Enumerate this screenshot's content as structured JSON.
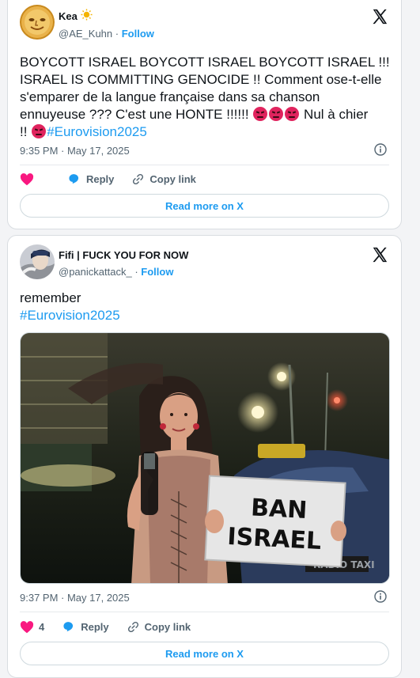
{
  "tweets": [
    {
      "display_name": "Kea",
      "name_emoji": "☀️",
      "handle": "@AE_Kuhn",
      "separator": "·",
      "follow_label": "Follow",
      "text_line1": "BOYCOTT ISRAEL BOYCOTT ISRAEL BOYCOTT ISRAEL !!!",
      "text_line2": "ISRAEL IS COMMITTING GENOCIDE !! Comment ose-t-elle",
      "text_line3": "s'emparer de la langue française dans sa chanson",
      "text_line4": "ennuyeuse ??? C'est une HONTE !!!!!!",
      "text_line4_end": "Nul à chier",
      "text_line5_start": "!!",
      "hashtag": "#Eurovision2025",
      "timestamp": "9:35 PM · May 17, 2025",
      "like_count": "",
      "reply_label": "Reply",
      "copy_label": "Copy link",
      "read_more_label": "Read more on X"
    },
    {
      "display_name": "Fifi | FUCK YOU FOR NOW",
      "handle": "@panickattack_",
      "separator": "·",
      "follow_label": "Follow",
      "text_line1": "remember",
      "hashtag": "#Eurovision2025",
      "sign_line1": "BAN",
      "sign_line2": "ISRAEL",
      "timestamp": "9:37 PM · May 17, 2025",
      "like_count": "4",
      "reply_label": "Reply",
      "copy_label": "Copy link",
      "read_more_label": "Read more on X"
    }
  ],
  "colors": {
    "accent": "#1d9bf0",
    "like": "#f91880",
    "angry_emoji": "#e0245e"
  },
  "icons": [
    "x-logo-icon",
    "info-icon",
    "heart-icon",
    "reply-bubble-icon",
    "link-icon",
    "angry-face-emoji"
  ]
}
